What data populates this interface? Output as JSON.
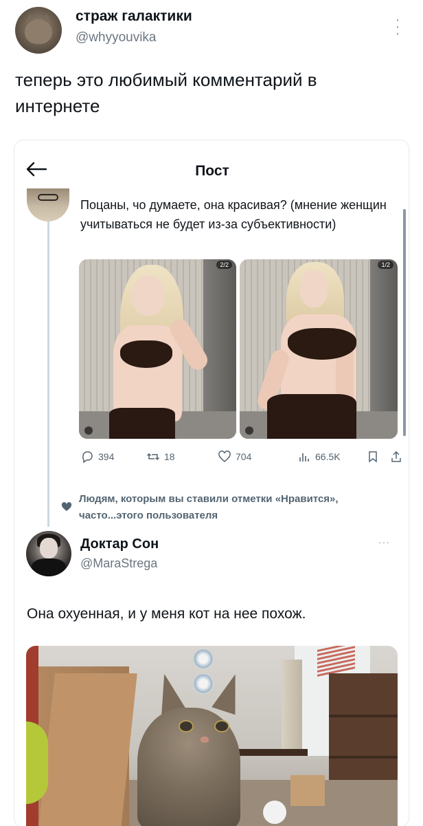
{
  "outer_post": {
    "author_name": "страж галактики",
    "author_handle": "@whyyouvika",
    "text": "теперь это любимый комментарий в интернете"
  },
  "embedded": {
    "header": {
      "title": "Пост"
    },
    "quoted_post": {
      "text": "Поцаны, чо думаете, она красивая? (мнение женщин учитываться не будет из-за субъективности)",
      "photos": [
        {
          "badge": "2/2"
        },
        {
          "badge": "1/2"
        }
      ],
      "actions": {
        "replies": "394",
        "reposts": "18",
        "likes": "704",
        "views": "66.5K"
      }
    },
    "liked_notice": "Людям, которым вы ставили отметки «Нравится», часто...этого пользователя",
    "reply": {
      "author_name": "Доктар Сон",
      "author_handle": "@MaraStrega",
      "text": "Она охуенная, и у меня кот на нее похож."
    }
  },
  "colors": {
    "text_primary": "#0f1419",
    "text_secondary": "#536471",
    "border": "#e6e9ec"
  },
  "icons": [
    "more-vertical-icon",
    "back-arrow-icon",
    "reply-icon",
    "repost-icon",
    "like-icon",
    "views-icon",
    "bookmark-icon",
    "share-icon",
    "heart-icon",
    "more-horizontal-icon"
  ]
}
